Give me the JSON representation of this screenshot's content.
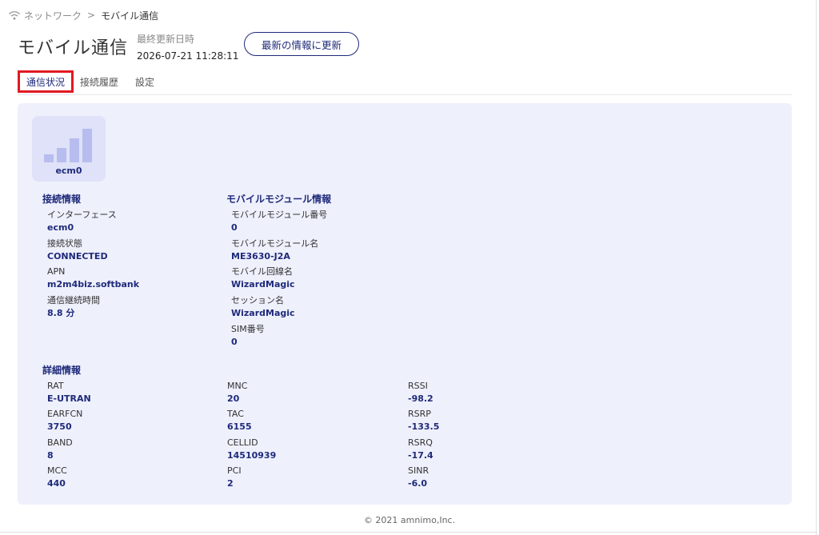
{
  "breadcrumb": {
    "parent": "ネットワーク",
    "separator": ">",
    "current": "モバイル通信"
  },
  "header": {
    "title": "モバイル通信",
    "updated_label": "最終更新日時",
    "updated_value": "2026-07-21 11:28:11",
    "refresh_label": "最新の情報に更新"
  },
  "tabs": [
    {
      "label": "通信状況",
      "active": true
    },
    {
      "label": "接続履歴",
      "active": false
    },
    {
      "label": "設定",
      "active": false
    }
  ],
  "device": {
    "name": "ecm0",
    "icon": "signal-bars-icon"
  },
  "connection": {
    "title": "接続情報",
    "fields": [
      {
        "label": "インターフェース",
        "value": "ecm0"
      },
      {
        "label": "接続状態",
        "value": "CONNECTED"
      },
      {
        "label": "APN",
        "value": "m2m4biz.softbank"
      },
      {
        "label": "通信継続時間",
        "value": "8.8 分"
      }
    ]
  },
  "module": {
    "title": "モバイルモジュール情報",
    "fields": [
      {
        "label": "モバイルモジュール番号",
        "value": "0"
      },
      {
        "label": "モバイルモジュール名",
        "value": "ME3630-J2A"
      },
      {
        "label": "モバイル回線名",
        "value": "WizardMagic"
      },
      {
        "label": "セッション名",
        "value": "WizardMagic"
      },
      {
        "label": "SIM番号",
        "value": "0"
      }
    ]
  },
  "details": {
    "title": "詳細情報",
    "col1": [
      {
        "label": "RAT",
        "value": "E-UTRAN"
      },
      {
        "label": "EARFCN",
        "value": "3750"
      },
      {
        "label": "BAND",
        "value": "8"
      },
      {
        "label": "MCC",
        "value": "440"
      }
    ],
    "col2": [
      {
        "label": "MNC",
        "value": "20"
      },
      {
        "label": "TAC",
        "value": "6155"
      },
      {
        "label": "CELLID",
        "value": "14510939"
      },
      {
        "label": "PCI",
        "value": "2"
      }
    ],
    "col3": [
      {
        "label": "RSSI",
        "value": "-98.2"
      },
      {
        "label": "RSRP",
        "value": "-133.5"
      },
      {
        "label": "RSRQ",
        "value": "-17.4"
      },
      {
        "label": "SINR",
        "value": "-6.0"
      }
    ]
  },
  "footer": {
    "copyright": "© 2021 amnimo,Inc."
  },
  "colors": {
    "accent": "#1f2a7a",
    "panel": "#eef0fc",
    "card": "#dfe2f8",
    "highlight": "#e01a22"
  }
}
